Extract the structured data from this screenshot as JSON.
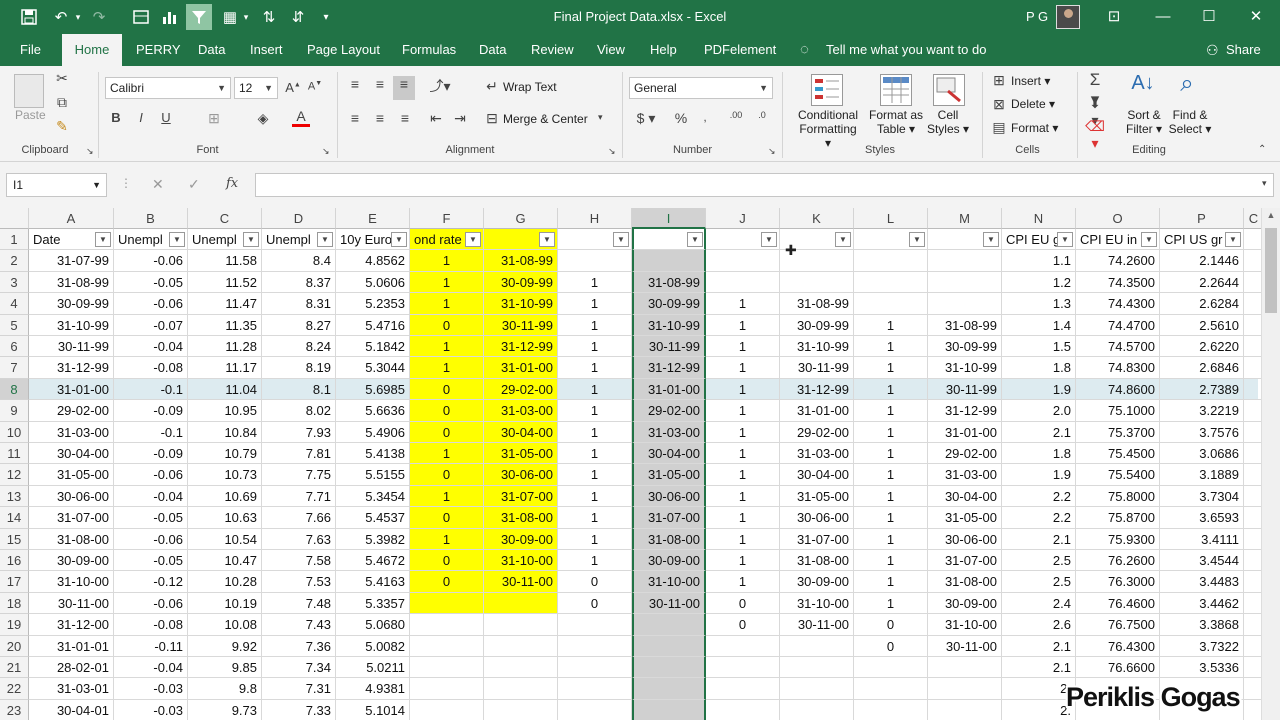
{
  "titlebar": {
    "title": "Final Project Data.xlsx  -  Excel",
    "user": "P G",
    "quick_access": [
      "save-icon",
      "undo-icon",
      "redo-icon",
      "print-preview-icon",
      "chart-icon",
      "filter-icon",
      "borders-icon",
      "sort-ascending-icon",
      "sort-descending-icon",
      "customize-icon"
    ]
  },
  "tabs": [
    {
      "label": "File"
    },
    {
      "label": "Home"
    },
    {
      "label": "PERRY"
    },
    {
      "label": "Data"
    },
    {
      "label": "Insert"
    },
    {
      "label": "Page Layout"
    },
    {
      "label": "Formulas"
    },
    {
      "label": "Data"
    },
    {
      "label": "Review"
    },
    {
      "label": "View"
    },
    {
      "label": "Help"
    },
    {
      "label": "PDFelement"
    }
  ],
  "tell_me": "Tell me what you want to do",
  "share": "Share",
  "ribbon": {
    "clipboard": {
      "paste": "Paste",
      "label": "Clipboard"
    },
    "font": {
      "name": "Calibri",
      "size": "12",
      "label": "Font"
    },
    "alignment": {
      "wrap": "Wrap Text",
      "merge": "Merge & Center",
      "label": "Alignment"
    },
    "number": {
      "format": "General",
      "label": "Number"
    },
    "styles": {
      "conditional": "Conditional",
      "conditional2": "Formatting",
      "format_table": "Format as",
      "format_table2": "Table",
      "cell_styles": "Cell",
      "cell_styles2": "Styles",
      "label": "Styles"
    },
    "cells": {
      "insert": "Insert",
      "delete": "Delete",
      "format": "Format",
      "label": "Cells"
    },
    "editing": {
      "sort": "Sort &",
      "sort2": "Filter",
      "find": "Find &",
      "find2": "Select",
      "label": "Editing"
    }
  },
  "namebox": "I1",
  "columns": [
    "A",
    "B",
    "C",
    "D",
    "E",
    "F",
    "G",
    "H",
    "I",
    "J",
    "K",
    "L",
    "M",
    "N",
    "O",
    "P",
    "C"
  ],
  "header_row": [
    "Date",
    "Unempl",
    "Unempl",
    "Unempl",
    "10y Euro",
    "ond rate",
    "",
    "",
    "",
    "",
    "",
    "",
    "",
    "CPI EU g",
    "CPI EU in",
    "CPI US gr",
    ""
  ],
  "rows": [
    [
      "31-07-99",
      "-0.06",
      "11.58",
      "8.4",
      "4.8562",
      "1",
      "31-08-99",
      "",
      "",
      "",
      "",
      "",
      "",
      "1.1",
      "74.2600",
      "2.1446"
    ],
    [
      "31-08-99",
      "-0.05",
      "11.52",
      "8.37",
      "5.0606",
      "1",
      "30-09-99",
      "1",
      "31-08-99",
      "",
      "",
      "",
      "",
      "1.2",
      "74.3500",
      "2.2644"
    ],
    [
      "30-09-99",
      "-0.06",
      "11.47",
      "8.31",
      "5.2353",
      "1",
      "31-10-99",
      "1",
      "30-09-99",
      "1",
      "31-08-99",
      "",
      "",
      "1.3",
      "74.4300",
      "2.6284"
    ],
    [
      "31-10-99",
      "-0.07",
      "11.35",
      "8.27",
      "5.4716",
      "0",
      "30-11-99",
      "1",
      "31-10-99",
      "1",
      "30-09-99",
      "1",
      "31-08-99",
      "1.4",
      "74.4700",
      "2.5610"
    ],
    [
      "30-11-99",
      "-0.04",
      "11.28",
      "8.24",
      "5.1842",
      "1",
      "31-12-99",
      "1",
      "30-11-99",
      "1",
      "31-10-99",
      "1",
      "30-09-99",
      "1.5",
      "74.5700",
      "2.6220"
    ],
    [
      "31-12-99",
      "-0.08",
      "11.17",
      "8.19",
      "5.3044",
      "1",
      "31-01-00",
      "1",
      "31-12-99",
      "1",
      "30-11-99",
      "1",
      "31-10-99",
      "1.8",
      "74.8300",
      "2.6846"
    ],
    [
      "31-01-00",
      "-0.1",
      "11.04",
      "8.1",
      "5.6985",
      "0",
      "29-02-00",
      "1",
      "31-01-00",
      "1",
      "31-12-99",
      "1",
      "30-11-99",
      "1.9",
      "74.8600",
      "2.7389"
    ],
    [
      "29-02-00",
      "-0.09",
      "10.95",
      "8.02",
      "5.6636",
      "0",
      "31-03-00",
      "1",
      "29-02-00",
      "1",
      "31-01-00",
      "1",
      "31-12-99",
      "2.0",
      "75.1000",
      "3.2219"
    ],
    [
      "31-03-00",
      "-0.1",
      "10.84",
      "7.93",
      "5.4906",
      "0",
      "30-04-00",
      "1",
      "31-03-00",
      "1",
      "29-02-00",
      "1",
      "31-01-00",
      "2.1",
      "75.3700",
      "3.7576"
    ],
    [
      "30-04-00",
      "-0.09",
      "10.79",
      "7.81",
      "5.4138",
      "1",
      "31-05-00",
      "1",
      "30-04-00",
      "1",
      "31-03-00",
      "1",
      "29-02-00",
      "1.8",
      "75.4500",
      "3.0686"
    ],
    [
      "31-05-00",
      "-0.06",
      "10.73",
      "7.75",
      "5.5155",
      "0",
      "30-06-00",
      "1",
      "31-05-00",
      "1",
      "30-04-00",
      "1",
      "31-03-00",
      "1.9",
      "75.5400",
      "3.1889"
    ],
    [
      "30-06-00",
      "-0.04",
      "10.69",
      "7.71",
      "5.3454",
      "1",
      "31-07-00",
      "1",
      "30-06-00",
      "1",
      "31-05-00",
      "1",
      "30-04-00",
      "2.2",
      "75.8000",
      "3.7304"
    ],
    [
      "31-07-00",
      "-0.05",
      "10.63",
      "7.66",
      "5.4537",
      "0",
      "31-08-00",
      "1",
      "31-07-00",
      "1",
      "30-06-00",
      "1",
      "31-05-00",
      "2.2",
      "75.8700",
      "3.6593"
    ],
    [
      "31-08-00",
      "-0.06",
      "10.54",
      "7.63",
      "5.3982",
      "1",
      "30-09-00",
      "1",
      "31-08-00",
      "1",
      "31-07-00",
      "1",
      "30-06-00",
      "2.1",
      "75.9300",
      "3.4111"
    ],
    [
      "30-09-00",
      "-0.05",
      "10.47",
      "7.58",
      "5.4672",
      "0",
      "31-10-00",
      "1",
      "30-09-00",
      "1",
      "31-08-00",
      "1",
      "31-07-00",
      "2.5",
      "76.2600",
      "3.4544"
    ],
    [
      "31-10-00",
      "-0.12",
      "10.28",
      "7.53",
      "5.4163",
      "0",
      "30-11-00",
      "0",
      "31-10-00",
      "1",
      "30-09-00",
      "1",
      "31-08-00",
      "2.5",
      "76.3000",
      "3.4483"
    ],
    [
      "30-11-00",
      "-0.06",
      "10.19",
      "7.48",
      "5.3357",
      "",
      "",
      "0",
      "30-11-00",
      "0",
      "31-10-00",
      "1",
      "30-09-00",
      "2.4",
      "76.4600",
      "3.4462"
    ],
    [
      "31-12-00",
      "-0.08",
      "10.08",
      "7.43",
      "5.0680",
      "",
      "",
      "",
      "",
      "0",
      "30-11-00",
      "0",
      "31-10-00",
      "2.6",
      "76.7500",
      "3.3868"
    ],
    [
      "31-01-01",
      "-0.11",
      "9.92",
      "7.36",
      "5.0082",
      "",
      "",
      "",
      "",
      "",
      "",
      "0",
      "30-11-00",
      "2.1",
      "76.4300",
      "3.7322"
    ],
    [
      "28-02-01",
      "-0.04",
      "9.85",
      "7.34",
      "5.0211",
      "",
      "",
      "",
      "",
      "",
      "",
      "",
      "",
      "2.1",
      "76.6600",
      "3.5336"
    ],
    [
      "31-03-01",
      "-0.03",
      "9.8",
      "7.31",
      "4.9381",
      "",
      "",
      "",
      "",
      "",
      "",
      "",
      "",
      "2.",
      "",
      ""
    ],
    [
      "30-04-01",
      "-0.03",
      "9.73",
      "7.33",
      "5.1014",
      "",
      "",
      "",
      "",
      "",
      "",
      "",
      "",
      "2.",
      "",
      ""
    ]
  ],
  "watermark": "Periklis Gogas"
}
